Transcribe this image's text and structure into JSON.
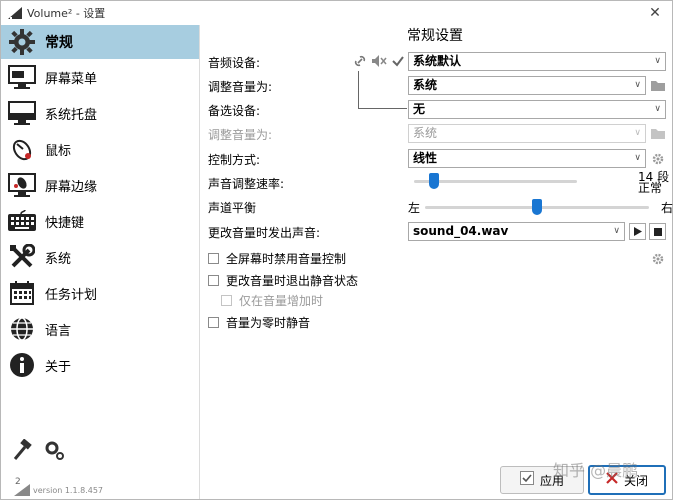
{
  "window": {
    "title": "Volume² - 设置",
    "close_glyph": "✕"
  },
  "sidebar": {
    "items": [
      {
        "label": "常规",
        "icon": "gear-icon",
        "active": true
      },
      {
        "label": "屏幕菜单",
        "icon": "screen-menu-icon"
      },
      {
        "label": "系统托盘",
        "icon": "system-tray-icon"
      },
      {
        "label": "鼠标",
        "icon": "mouse-icon"
      },
      {
        "label": "屏幕边缘",
        "icon": "screen-edge-icon"
      },
      {
        "label": "快捷键",
        "icon": "keyboard-icon"
      },
      {
        "label": "系统",
        "icon": "tools-icon"
      },
      {
        "label": "任务计划",
        "icon": "calendar-icon"
      },
      {
        "label": "语言",
        "icon": "globe-icon"
      },
      {
        "label": "关于",
        "icon": "info-icon"
      }
    ],
    "version": "version 1.1.8.457",
    "logo_text": "2"
  },
  "main": {
    "title": "常规设置",
    "audio_device_label": "音频设备:",
    "audio_device_value": "系统默认",
    "adjust_volume_label": "调整音量为:",
    "adjust_volume_value": "系统",
    "backup_device_label": "备选设备:",
    "backup_device_value": "无",
    "adjust_volume2_label": "调整音量为:",
    "adjust_volume2_value": "系统",
    "control_mode_label": "控制方式:",
    "control_mode_value": "线性",
    "speed_label": "声音调整速率:",
    "speed_value": "14 段",
    "speed_mode": "正常",
    "speed_fraction": 0.12,
    "balance_label": "声道平衡",
    "balance_left": "左",
    "balance_right": "右",
    "balance_fraction": 0.5,
    "sound_label": "更改音量时发出声音:",
    "sound_value": "sound_04.wav",
    "checkboxes": {
      "fullscreen": "全屏幕时禁用音量控制",
      "exit_mute": "更改音量时退出静音状态",
      "only_increase": "仅在音量增加时",
      "mute_zero": "音量为零时静音"
    }
  },
  "footer": {
    "apply_label": "应用",
    "close_label": "关闭"
  },
  "watermark": "知乎 @晨鹏"
}
